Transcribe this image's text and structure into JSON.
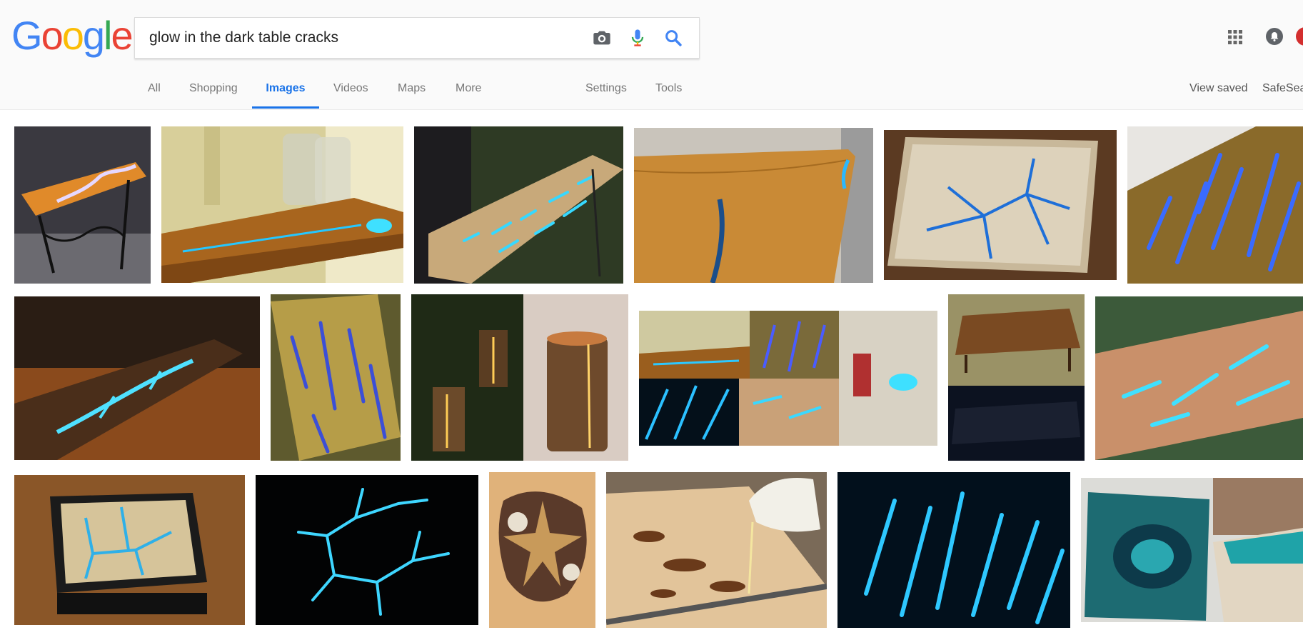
{
  "logo": {
    "letters": [
      "G",
      "o",
      "o",
      "g",
      "l",
      "e"
    ]
  },
  "search": {
    "query": "glow in the dark table cracks"
  },
  "icons": {
    "camera": "camera-icon",
    "mic": "microphone-icon",
    "search": "search-icon",
    "apps": "apps-grid-icon",
    "notifications": "bell-icon"
  },
  "tabs": {
    "all": "All",
    "shopping": "Shopping",
    "images": "Images",
    "videos": "Videos",
    "maps": "Maps",
    "more": "More",
    "settings": "Settings",
    "tools": "Tools"
  },
  "right_links": {
    "view_saved": "View saved",
    "safesearch": "SafeSea"
  },
  "colors": {
    "active_tab": "#1a73e8",
    "glow_blue": "#2fd3ff",
    "wood": "#b8752a"
  }
}
